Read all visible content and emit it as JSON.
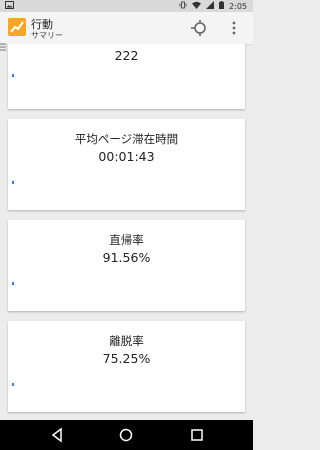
{
  "status": {
    "time": "2:05"
  },
  "header": {
    "title": "行動",
    "subtitle": "サマリー"
  },
  "cards": [
    {
      "label": "",
      "value": "222"
    },
    {
      "label": "平均ページ滞在時間",
      "value": "00:01:43"
    },
    {
      "label": "直帰率",
      "value": "91.56%"
    },
    {
      "label": "離脱率",
      "value": "75.25%"
    }
  ],
  "colors": {
    "accent": "#f5a623",
    "chart_dot": "#3b7fd9"
  }
}
